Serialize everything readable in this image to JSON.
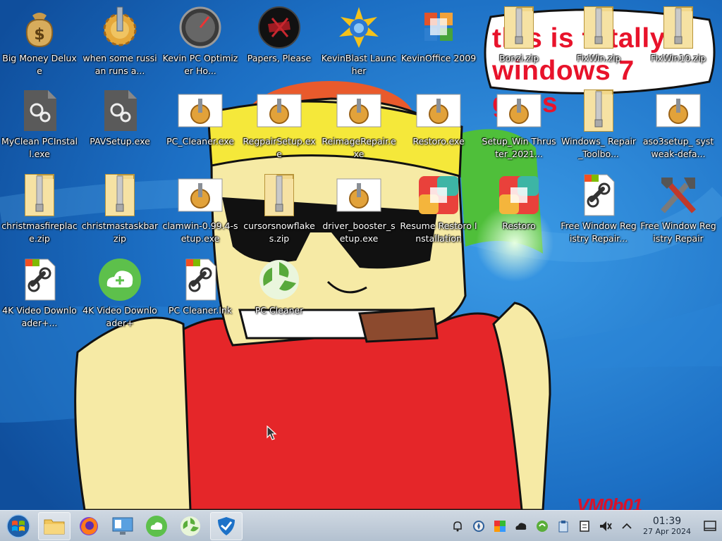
{
  "bubble": {
    "text": "this is totally windows 7 guys"
  },
  "signature": "VM0b01",
  "desktop_icons": [
    {
      "label": "Big Money Deluxe",
      "icon": "money-bag-icon"
    },
    {
      "label": "when some russian runs a...",
      "icon": "gear-icon"
    },
    {
      "label": "Kevin PC Optimizer Ho...",
      "icon": "speedometer-icon"
    },
    {
      "label": "Papers, Please",
      "icon": "papers-please-icon"
    },
    {
      "label": "KevinBlast Launcher",
      "icon": "kevinblast-icon"
    },
    {
      "label": "KevinOffice 2009",
      "icon": "office-icon"
    },
    {
      "label": "Bonzi.zip",
      "icon": "zip-folder-icon"
    },
    {
      "label": "FixWin.zip",
      "icon": "zip-folder-icon"
    },
    {
      "label": "FixWin10.zip",
      "icon": "zip-folder-icon"
    },
    {
      "label": "MyClean PCInstall.exe",
      "icon": "exe-settings-icon"
    },
    {
      "label": "PAVSetup.exe",
      "icon": "exe-settings-icon"
    },
    {
      "label": "PC_Cleaner.exe",
      "icon": "installer-icon"
    },
    {
      "label": "RegpairSetup.exe",
      "icon": "installer-icon"
    },
    {
      "label": "ReimageRepair.exe",
      "icon": "installer-icon"
    },
    {
      "label": "Restoro.exe",
      "icon": "installer-icon"
    },
    {
      "label": "Setup_Win Thruster_2021...",
      "icon": "installer-icon"
    },
    {
      "label": "Windows_ Repair_Toolbo...",
      "icon": "zip-folder-icon"
    },
    {
      "label": "aso3setup_ systweak-defa...",
      "icon": "installer-icon"
    },
    {
      "label": "christmasfireplace.zip",
      "icon": "zip-folder-icon"
    },
    {
      "label": "christmastaskbarzip",
      "icon": "zip-folder-icon"
    },
    {
      "label": "clamwin-0.99.4-setup.exe",
      "icon": "installer-icon"
    },
    {
      "label": "cursorsnowflakes.zip",
      "icon": "zip-folder-icon"
    },
    {
      "label": "driver_booster_setup.exe",
      "icon": "installer-icon"
    },
    {
      "label": "Resume Restoro Installation",
      "icon": "restoro-icon"
    },
    {
      "label": "Restoro",
      "icon": "restoro-icon"
    },
    {
      "label": "Free Window Registry Repair...",
      "icon": "shortcut-link-icon"
    },
    {
      "label": "Free Window Registry Repair",
      "icon": "tools-icon"
    },
    {
      "label": "4K Video Downloader+...",
      "icon": "shortcut-link-icon"
    },
    {
      "label": "4K Video Downloader+",
      "icon": "cloud-download-icon"
    },
    {
      "label": "PC Cleaner.lnk",
      "icon": "shortcut-link-icon"
    },
    {
      "label": "PC Cleaner",
      "icon": "pc-cleaner-icon"
    }
  ],
  "taskbar": {
    "items": [
      {
        "name": "start-button",
        "icon": "windows-orb-icon"
      },
      {
        "name": "file-manager-task",
        "icon": "folder-icon"
      },
      {
        "name": "firefox-task",
        "icon": "firefox-icon"
      },
      {
        "name": "control-panel-task",
        "icon": "monitor-icon"
      },
      {
        "name": "4k-downloader-task",
        "icon": "cloud-download-icon"
      },
      {
        "name": "pc-cleaner-task",
        "icon": "pc-cleaner-icon"
      },
      {
        "name": "antivirus-task",
        "icon": "shield-icon"
      }
    ],
    "tray": [
      "bell-icon",
      "compass-icon",
      "color-square-icon",
      "cloud-icon",
      "green-recycle-icon",
      "clipboard-icon",
      "notes-icon",
      "mute-icon",
      "chevron-up-icon"
    ],
    "clock": {
      "time": "01:39",
      "date": "27 Apr 2024"
    }
  },
  "colors": {
    "bubble_text": "#e8132b",
    "desktop_bg": "#1b73c9",
    "taskbar_bg": "#c3ceda"
  }
}
